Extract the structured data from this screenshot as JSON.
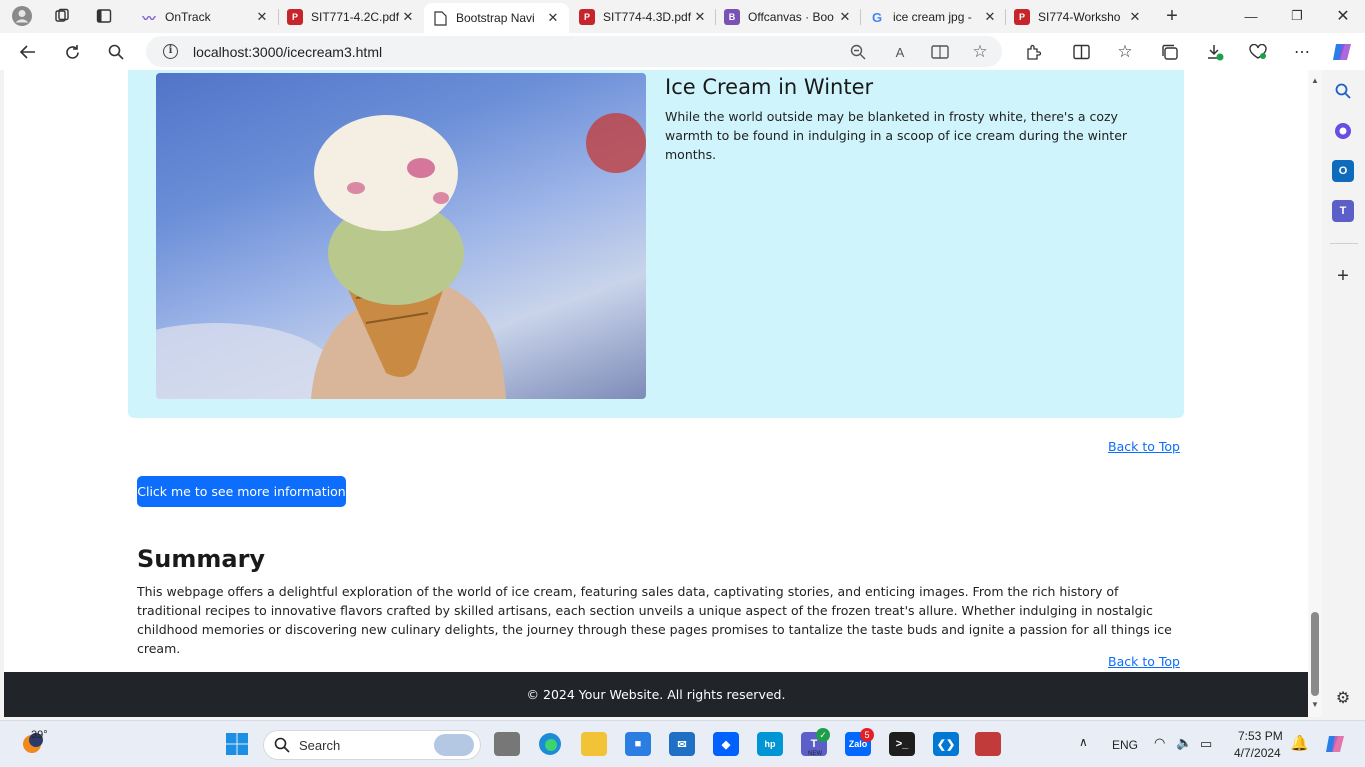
{
  "browser": {
    "tabs": [
      {
        "title": "OnTrack",
        "icon": "ontrack-icon"
      },
      {
        "title": "SIT771-4.2C.pdf",
        "icon": "pdf-icon"
      },
      {
        "title": "Bootstrap Navi",
        "icon": "page-icon"
      },
      {
        "title": "SIT774-4.3D.pdf",
        "icon": "pdf-icon"
      },
      {
        "title": "Offcanvas · Boo",
        "icon": "bootstrap-icon"
      },
      {
        "title": "ice cream jpg -",
        "icon": "google-icon"
      },
      {
        "title": "SI774-Worksho",
        "icon": "pdf-icon"
      }
    ],
    "active_tab_index": 2,
    "url": "localhost:3000/icecream3.html"
  },
  "page": {
    "hero": {
      "title": "Ice Cream in Winter",
      "text": "While the world outside may be blanketed in frosty white, there's a cozy warmth to be found in indulging in a scoop of ice cream during the winter months.",
      "image_alt": "ice cream cone held against blue sky"
    },
    "back_to_top": "Back to Top",
    "more_info_button": "Click me to see more information",
    "summary": {
      "heading": "Summary",
      "text": "This webpage offers a delightful exploration of the world of ice cream, featuring sales data, captivating stories, and enticing images. From the rich history of traditional recipes to innovative flavors crafted by skilled artisans, each section unveils a unique aspect of the frozen treat's allure. Whether indulging in nostalgic childhood memories or discovering new culinary delights, the journey through these pages promises to tantalize the taste buds and ignite a passion for all things ice cream."
    },
    "footer": "© 2024 Your Website. All rights reserved."
  },
  "taskbar": {
    "weather_temp": "39°",
    "search_placeholder": "Search",
    "teams_badge": "NEW",
    "zalo_badge": "5",
    "language": "ENG",
    "time": "7:53 PM",
    "date": "4/7/2024"
  },
  "colors": {
    "hero_bg": "#cff4fc",
    "primary": "#0d6efd",
    "footer_bg": "#212529"
  }
}
